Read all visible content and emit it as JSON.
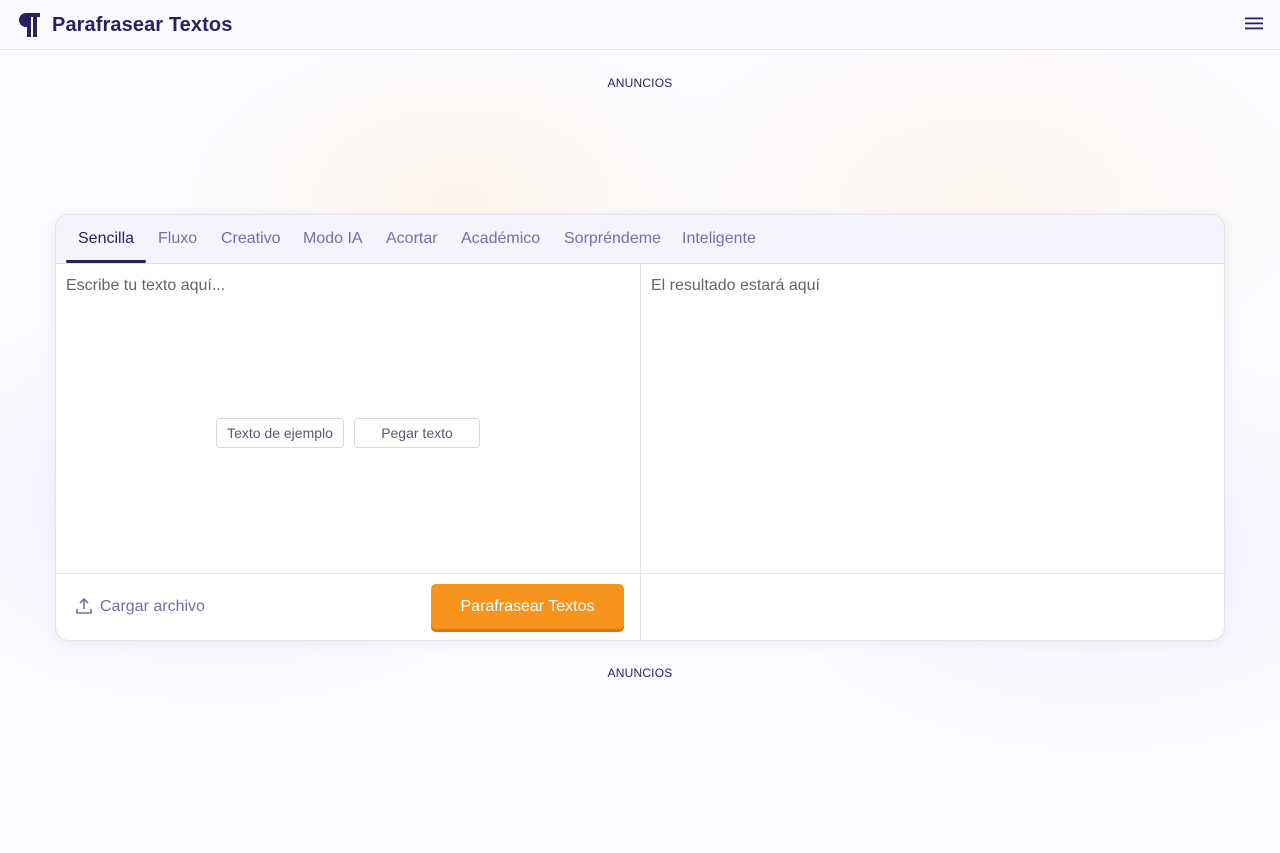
{
  "header": {
    "logo_icon": "pilcrow-icon",
    "brand": "Parafrasear Textos",
    "menu_icon": "hamburger-menu-icon"
  },
  "ads": {
    "top_label": "ANUNCIOS",
    "bottom_label": "ANUNCIOS"
  },
  "tabs": [
    {
      "label": "Sencilla",
      "active": true
    },
    {
      "label": "Fluxo",
      "active": false
    },
    {
      "label": "Creativo",
      "active": false
    },
    {
      "label": "Modo IA",
      "active": false
    },
    {
      "label": "Acortar",
      "active": false
    },
    {
      "label": "Académico",
      "active": false
    },
    {
      "label": "Sorpréndeme",
      "active": false
    },
    {
      "label": "Inteligente",
      "active": false
    }
  ],
  "input": {
    "value": "",
    "placeholder": "Escribe tu texto aquí...",
    "example_button": "Texto de ejemplo",
    "paste_button": "Pegar texto"
  },
  "output": {
    "placeholder": "El resultado estará aquí"
  },
  "footer": {
    "upload_icon": "upload-icon",
    "upload_label": "Cargar archivo",
    "submit_label": "Parafrasear Textos"
  },
  "colors": {
    "brand": "#2a2060",
    "tab_inactive": "#7e6aa8",
    "accent": "#f7941d"
  }
}
